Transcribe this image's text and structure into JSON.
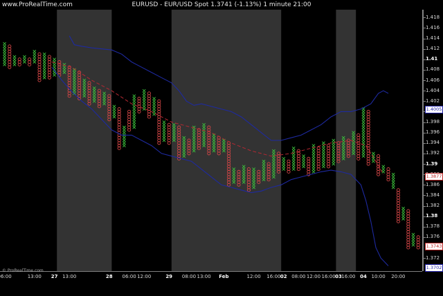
{
  "header": {
    "brand": "www.ProRealTime.com",
    "title": "EURUSD - EUR/USD Spot   1.3741 (-1.13%)   1 minute  21:00"
  },
  "footer": {
    "copyright": "© ProRealTime.com"
  },
  "price_badges": [
    {
      "text": "1.4005",
      "value": 1.4005,
      "fg": "#2222aa",
      "border": "#2222aa",
      "bg": "#ffffff"
    },
    {
      "text": "1.3877",
      "value": 1.3877,
      "fg": "#bb2222",
      "border": "#bb2222",
      "bg": "#ffffff"
    },
    {
      "text": "1.3743",
      "value": 1.3743,
      "fg": "#bb2222",
      "border": "#bb2222",
      "bg": "#ffffff"
    },
    {
      "text": "1.3702",
      "value": 1.3702,
      "fg": "#2222aa",
      "border": "#2222aa",
      "bg": "#ffffff"
    }
  ],
  "colors": {
    "background": "#000000",
    "session_band": "#333333",
    "x_mark": "#3cbe3c",
    "o_mark": "#d24646",
    "bollinger_band": "#1e2aa0",
    "moving_average": "#b42832",
    "axis_text": "#d8d8d8"
  },
  "chart_data": {
    "type": "point-and-figure",
    "instrument": "EURUSD - EUR/USD Spot",
    "last_price": 1.3741,
    "change_pct": "-1.13%",
    "timeframe": "1 minute",
    "ylim": [
      1.3695,
      1.4195
    ],
    "yticks": [
      {
        "v": 1.418,
        "label": "1.418",
        "bold": false
      },
      {
        "v": 1.416,
        "label": "1.416",
        "bold": false
      },
      {
        "v": 1.414,
        "label": "1.414",
        "bold": false
      },
      {
        "v": 1.412,
        "label": "1.412",
        "bold": false
      },
      {
        "v": 1.41,
        "label": "1.41",
        "bold": true
      },
      {
        "v": 1.408,
        "label": "1.408",
        "bold": false
      },
      {
        "v": 1.406,
        "label": "1.406",
        "bold": false
      },
      {
        "v": 1.404,
        "label": "1.404",
        "bold": false
      },
      {
        "v": 1.402,
        "label": "1.402",
        "bold": false
      },
      {
        "v": 1.4,
        "label": "1.4",
        "bold": true
      },
      {
        "v": 1.398,
        "label": "1.398",
        "bold": false
      },
      {
        "v": 1.396,
        "label": "1.396",
        "bold": false
      },
      {
        "v": 1.394,
        "label": "1.394",
        "bold": false
      },
      {
        "v": 1.392,
        "label": "1.392",
        "bold": false
      },
      {
        "v": 1.39,
        "label": "1.39",
        "bold": true
      },
      {
        "v": 1.388,
        "label": "1.388",
        "bold": false
      },
      {
        "v": 1.386,
        "label": "1.386",
        "bold": false
      },
      {
        "v": 1.384,
        "label": "1.384",
        "bold": false
      },
      {
        "v": 1.382,
        "label": "1.382",
        "bold": false
      },
      {
        "v": 1.38,
        "label": "1.38",
        "bold": true
      },
      {
        "v": 1.378,
        "label": "1.378",
        "bold": false
      },
      {
        "v": 1.376,
        "label": "1.376",
        "bold": false
      },
      {
        "v": 1.372,
        "label": "1.372",
        "bold": false
      }
    ],
    "xticks": [
      {
        "label": "06:00",
        "t": 0.5,
        "day": false
      },
      {
        "label": "13:00",
        "t": 6.5,
        "day": false
      },
      {
        "label": "27",
        "t": 10.5,
        "day": true
      },
      {
        "label": "13:00",
        "t": 13.5,
        "day": false
      },
      {
        "label": "28",
        "t": 21.5,
        "day": true
      },
      {
        "label": "06:00",
        "t": 25.5,
        "day": false
      },
      {
        "label": "12:00",
        "t": 28.5,
        "day": false
      },
      {
        "label": "29",
        "t": 33.5,
        "day": true
      },
      {
        "label": "08:00",
        "t": 37.5,
        "day": false
      },
      {
        "label": "13:00",
        "t": 40.5,
        "day": false
      },
      {
        "label": "Feb",
        "t": 44.5,
        "day": true
      },
      {
        "label": "12:00",
        "t": 50.5,
        "day": false
      },
      {
        "label": "16:00",
        "t": 54.5,
        "day": false
      },
      {
        "label": "02",
        "t": 56.5,
        "day": true
      },
      {
        "label": "08:00",
        "t": 59.5,
        "day": false
      },
      {
        "label": "12:00",
        "t": 62.5,
        "day": false
      },
      {
        "label": "16:00",
        "t": 65.5,
        "day": false
      },
      {
        "label": "03",
        "t": 67.5,
        "day": true
      },
      {
        "label": "16:00",
        "t": 69.5,
        "day": false
      },
      {
        "label": "04",
        "t": 72.5,
        "day": true
      },
      {
        "label": "10:00",
        "t": 75.5,
        "day": false
      },
      {
        "label": "20:00",
        "t": 79.5,
        "day": false
      }
    ],
    "session_bands": [
      [
        11,
        22
      ],
      [
        34,
        56
      ],
      [
        67,
        71
      ]
    ],
    "columns": [
      {
        "type": "X",
        "low": 1.409,
        "high": 1.413
      },
      {
        "type": "O",
        "low": 1.4085,
        "high": 1.4125
      },
      {
        "type": "X",
        "low": 1.409,
        "high": 1.4105
      },
      {
        "type": "O",
        "low": 1.409,
        "high": 1.41
      },
      {
        "type": "X",
        "low": 1.4095,
        "high": 1.4105
      },
      {
        "type": "O",
        "low": 1.409,
        "high": 1.41
      },
      {
        "type": "X",
        "low": 1.4095,
        "high": 1.4115
      },
      {
        "type": "O",
        "low": 1.406,
        "high": 1.411
      },
      {
        "type": "X",
        "low": 1.4065,
        "high": 1.411
      },
      {
        "type": "O",
        "low": 1.4065,
        "high": 1.4105
      },
      {
        "type": "X",
        "low": 1.407,
        "high": 1.41
      },
      {
        "type": "O",
        "low": 1.407,
        "high": 1.4095
      },
      {
        "type": "X",
        "low": 1.4075,
        "high": 1.409
      },
      {
        "type": "O",
        "low": 1.403,
        "high": 1.4085
      },
      {
        "type": "X",
        "low": 1.4035,
        "high": 1.408
      },
      {
        "type": "O",
        "low": 1.4025,
        "high": 1.4075
      },
      {
        "type": "X",
        "low": 1.403,
        "high": 1.406
      },
      {
        "type": "O",
        "low": 1.4015,
        "high": 1.4055
      },
      {
        "type": "X",
        "low": 1.402,
        "high": 1.4045
      },
      {
        "type": "O",
        "low": 1.401,
        "high": 1.404
      },
      {
        "type": "X",
        "low": 1.4015,
        "high": 1.4035
      },
      {
        "type": "O",
        "low": 1.3985,
        "high": 1.403
      },
      {
        "type": "X",
        "low": 1.399,
        "high": 1.401
      },
      {
        "type": "O",
        "low": 1.393,
        "high": 1.4005
      },
      {
        "type": "X",
        "low": 1.3935,
        "high": 1.397
      },
      {
        "type": "O",
        "low": 1.3965,
        "high": 1.4
      },
      {
        "type": "X",
        "low": 1.397,
        "high": 1.403
      },
      {
        "type": "O",
        "low": 1.4,
        "high": 1.4025
      },
      {
        "type": "X",
        "low": 1.4005,
        "high": 1.404
      },
      {
        "type": "O",
        "low": 1.399,
        "high": 1.4035
      },
      {
        "type": "X",
        "low": 1.3995,
        "high": 1.4025
      },
      {
        "type": "O",
        "low": 1.394,
        "high": 1.402
      },
      {
        "type": "X",
        "low": 1.3945,
        "high": 1.398
      },
      {
        "type": "O",
        "low": 1.394,
        "high": 1.3975
      },
      {
        "type": "X",
        "low": 1.3945,
        "high": 1.3975
      },
      {
        "type": "O",
        "low": 1.391,
        "high": 1.397
      },
      {
        "type": "X",
        "low": 1.3915,
        "high": 1.395
      },
      {
        "type": "O",
        "low": 1.392,
        "high": 1.3945
      },
      {
        "type": "X",
        "low": 1.3925,
        "high": 1.397
      },
      {
        "type": "O",
        "low": 1.393,
        "high": 1.3965
      },
      {
        "type": "X",
        "low": 1.3935,
        "high": 1.3975
      },
      {
        "type": "O",
        "low": 1.392,
        "high": 1.397
      },
      {
        "type": "X",
        "low": 1.3925,
        "high": 1.3955
      },
      {
        "type": "O",
        "low": 1.392,
        "high": 1.395
      },
      {
        "type": "X",
        "low": 1.3925,
        "high": 1.3945
      },
      {
        "type": "O",
        "low": 1.386,
        "high": 1.394
      },
      {
        "type": "X",
        "low": 1.3865,
        "high": 1.389
      },
      {
        "type": "O",
        "low": 1.386,
        "high": 1.3885
      },
      {
        "type": "X",
        "low": 1.3865,
        "high": 1.3895
      },
      {
        "type": "O",
        "low": 1.385,
        "high": 1.389
      },
      {
        "type": "X",
        "low": 1.3855,
        "high": 1.389
      },
      {
        "type": "O",
        "low": 1.3865,
        "high": 1.3885
      },
      {
        "type": "X",
        "low": 1.387,
        "high": 1.3905
      },
      {
        "type": "O",
        "low": 1.387,
        "high": 1.39
      },
      {
        "type": "X",
        "low": 1.3875,
        "high": 1.3925
      },
      {
        "type": "O",
        "low": 1.3885,
        "high": 1.392
      },
      {
        "type": "X",
        "low": 1.389,
        "high": 1.391
      },
      {
        "type": "O",
        "low": 1.3885,
        "high": 1.3905
      },
      {
        "type": "X",
        "low": 1.389,
        "high": 1.393
      },
      {
        "type": "O",
        "low": 1.389,
        "high": 1.3925
      },
      {
        "type": "X",
        "low": 1.3895,
        "high": 1.3915
      },
      {
        "type": "O",
        "low": 1.388,
        "high": 1.391
      },
      {
        "type": "X",
        "low": 1.3885,
        "high": 1.3935
      },
      {
        "type": "O",
        "low": 1.389,
        "high": 1.393
      },
      {
        "type": "X",
        "low": 1.3895,
        "high": 1.394
      },
      {
        "type": "O",
        "low": 1.3895,
        "high": 1.3935
      },
      {
        "type": "X",
        "low": 1.39,
        "high": 1.3945
      },
      {
        "type": "O",
        "low": 1.3905,
        "high": 1.394
      },
      {
        "type": "X",
        "low": 1.391,
        "high": 1.395
      },
      {
        "type": "O",
        "low": 1.3915,
        "high": 1.3945
      },
      {
        "type": "X",
        "low": 1.392,
        "high": 1.396
      },
      {
        "type": "O",
        "low": 1.391,
        "high": 1.3955
      },
      {
        "type": "X",
        "low": 1.3915,
        "high": 1.4005
      },
      {
        "type": "O",
        "low": 1.39,
        "high": 1.4
      },
      {
        "type": "X",
        "low": 1.3905,
        "high": 1.392
      },
      {
        "type": "O",
        "low": 1.388,
        "high": 1.3915
      },
      {
        "type": "X",
        "low": 1.3885,
        "high": 1.3895
      },
      {
        "type": "O",
        "low": 1.387,
        "high": 1.389
      },
      {
        "type": "X",
        "low": 1.3855,
        "high": 1.388
      },
      {
        "type": "O",
        "low": 1.379,
        "high": 1.385
      },
      {
        "type": "X",
        "low": 1.3795,
        "high": 1.3815
      },
      {
        "type": "O",
        "low": 1.374,
        "high": 1.381
      },
      {
        "type": "X",
        "low": 1.3745,
        "high": 1.3765
      },
      {
        "type": "O",
        "low": 1.374,
        "high": 1.376
      }
    ],
    "series": [
      {
        "name": "",
        "style": "upper-band",
        "points": [
          [
            13.5,
            1.4145
          ],
          [
            14.5,
            1.4128
          ],
          [
            16,
            1.4125
          ],
          [
            18,
            1.4122
          ],
          [
            20,
            1.412
          ],
          [
            22,
            1.4118
          ],
          [
            24,
            1.411
          ],
          [
            26,
            1.4095
          ],
          [
            28,
            1.4085
          ],
          [
            30,
            1.4075
          ],
          [
            32,
            1.4065
          ],
          [
            34,
            1.4055
          ],
          [
            35.5,
            1.404
          ],
          [
            37,
            1.402
          ],
          [
            38.5,
            1.4012
          ],
          [
            40,
            1.4015
          ],
          [
            42,
            1.401
          ],
          [
            44,
            1.4005
          ],
          [
            46,
            1.4
          ],
          [
            48,
            1.399
          ],
          [
            50,
            1.3975
          ],
          [
            52,
            1.396
          ],
          [
            54,
            1.3945
          ],
          [
            56,
            1.3945
          ],
          [
            58,
            1.395
          ],
          [
            60,
            1.3955
          ],
          [
            62,
            1.3965
          ],
          [
            64,
            1.3975
          ],
          [
            66,
            1.399
          ],
          [
            68,
            1.4
          ],
          [
            70,
            1.4
          ],
          [
            72,
            1.4005
          ],
          [
            74,
            1.4015
          ],
          [
            75.5,
            1.4035
          ],
          [
            76.5,
            1.404
          ],
          [
            77.5,
            1.4035
          ]
        ]
      },
      {
        "name": "",
        "style": "lower-band",
        "points": [
          [
            10,
            1.4085
          ],
          [
            12,
            1.406
          ],
          [
            14,
            1.4038
          ],
          [
            16,
            1.402
          ],
          [
            18,
            1.4005
          ],
          [
            20,
            1.3985
          ],
          [
            22,
            1.3965
          ],
          [
            24,
            1.3955
          ],
          [
            26,
            1.3955
          ],
          [
            28,
            1.3945
          ],
          [
            30,
            1.3935
          ],
          [
            32,
            1.392
          ],
          [
            34,
            1.3915
          ],
          [
            36,
            1.391
          ],
          [
            38,
            1.3905
          ],
          [
            40,
            1.389
          ],
          [
            42,
            1.3875
          ],
          [
            44,
            1.386
          ],
          [
            46,
            1.3855
          ],
          [
            48,
            1.385
          ],
          [
            50,
            1.3845
          ],
          [
            52,
            1.3848
          ],
          [
            54,
            1.3855
          ],
          [
            56,
            1.386
          ],
          [
            58,
            1.387
          ],
          [
            60,
            1.3875
          ],
          [
            62,
            1.388
          ],
          [
            64,
            1.3885
          ],
          [
            66,
            1.3888
          ],
          [
            68,
            1.3885
          ],
          [
            70,
            1.388
          ],
          [
            72,
            1.386
          ],
          [
            73,
            1.383
          ],
          [
            74,
            1.379
          ],
          [
            75,
            1.374
          ],
          [
            76,
            1.372
          ],
          [
            77.5,
            1.3705
          ]
        ]
      },
      {
        "name": "",
        "style": "moving-average",
        "points": [
          [
            10,
            1.4095
          ],
          [
            14,
            1.4085
          ],
          [
            18,
            1.406
          ],
          [
            22,
            1.404
          ],
          [
            26,
            1.4015
          ],
          [
            30,
            1.4
          ],
          [
            34,
            1.398
          ],
          [
            38,
            1.397
          ],
          [
            42,
            1.396
          ],
          [
            46,
            1.394
          ],
          [
            50,
            1.3925
          ],
          [
            54,
            1.3915
          ],
          [
            58,
            1.392
          ],
          [
            62,
            1.393
          ],
          [
            66,
            1.394
          ],
          [
            70,
            1.3945
          ],
          [
            73,
            1.3935
          ],
          [
            75,
            1.3905
          ],
          [
            76.5,
            1.388
          ]
        ]
      }
    ]
  }
}
